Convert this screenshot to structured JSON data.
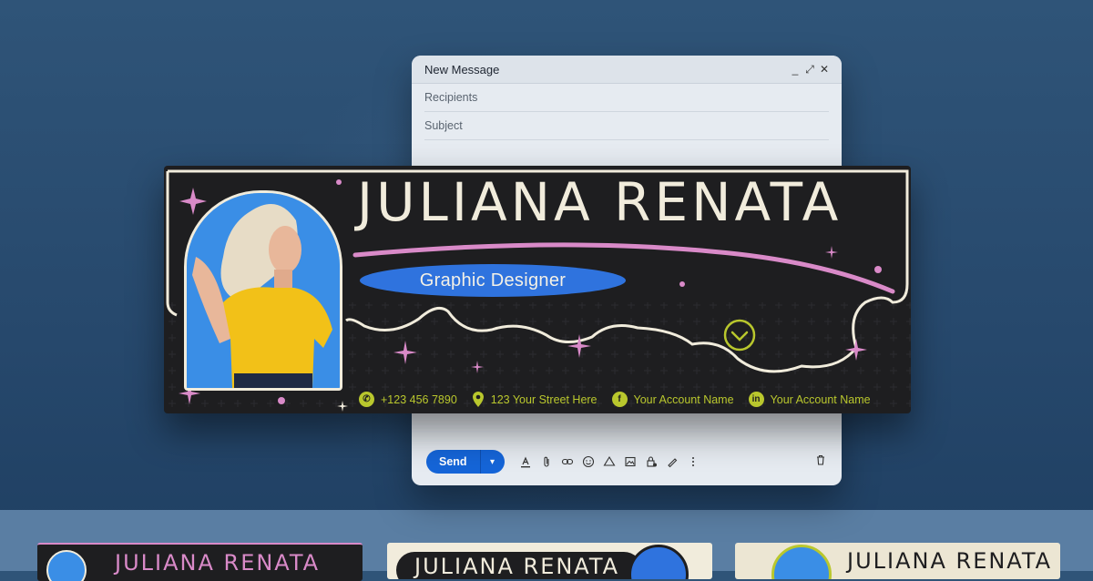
{
  "compose": {
    "title": "New Message",
    "minimize_glyph": "_",
    "expand_glyph": "⤢",
    "close_glyph": "✕",
    "recipients_placeholder": "Recipients",
    "subject_placeholder": "Subject",
    "send_label": "Send",
    "send_more_glyph": "▾"
  },
  "toolbar_icons": [
    "format-text-icon",
    "attach-icon",
    "link-icon",
    "emoji-icon",
    "drive-icon",
    "image-icon",
    "lock-clock-icon",
    "pen-icon",
    "more-vertical-icon"
  ],
  "signature": {
    "name": "JULIANA RENATA",
    "role": "Graphic Designer",
    "contacts": [
      {
        "icon": "whatsapp-icon",
        "text": "+123 456 7890"
      },
      {
        "icon": "location-pin-icon",
        "text": "123 Your Street Here"
      },
      {
        "icon": "facebook-icon",
        "text": "Your Account Name"
      },
      {
        "icon": "linkedin-icon",
        "text": "Your Account Name"
      }
    ],
    "colors": {
      "background": "#1e1e20",
      "cream": "#f1ecdc",
      "pink": "#d98ac8",
      "blue": "#2f73de",
      "lime": "#b9c72d"
    }
  },
  "thumbnails": [
    {
      "text": "JULIANA RENATA"
    },
    {
      "text": "JULIANA RENATA"
    },
    {
      "text": "JULIANA RENATA"
    }
  ]
}
